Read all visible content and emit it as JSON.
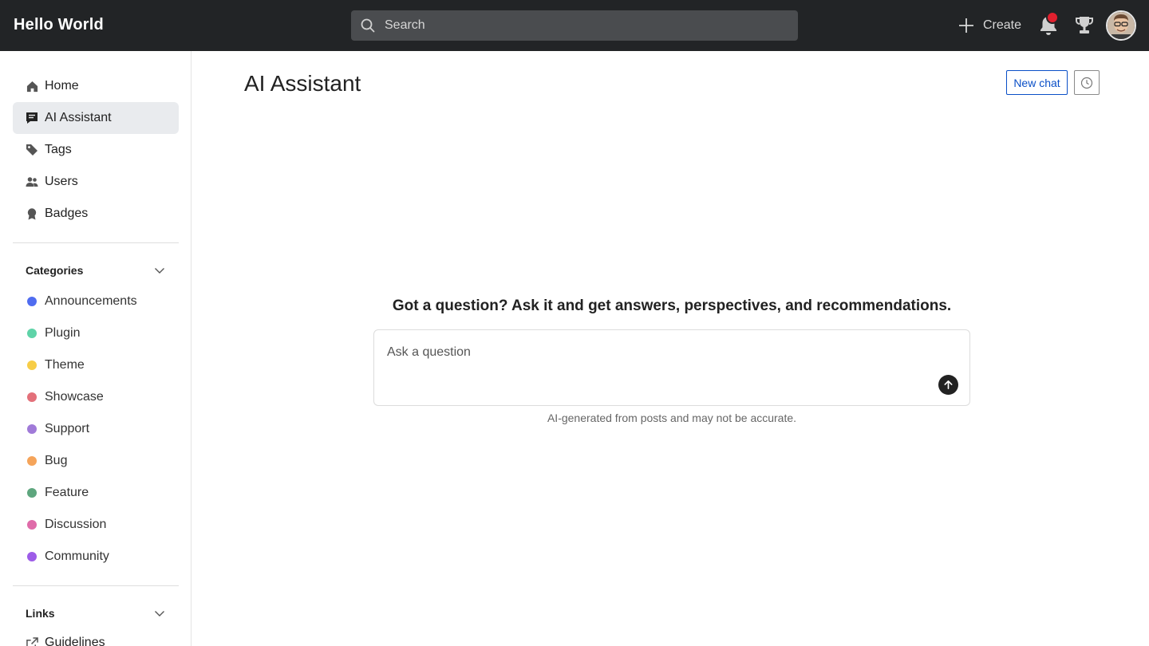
{
  "header": {
    "brand": "Hello World",
    "search_placeholder": "Search",
    "create_label": "Create",
    "notification_color": "#e0202e"
  },
  "sidebar": {
    "nav": [
      {
        "label": "Home",
        "icon": "home-icon"
      },
      {
        "label": "AI Assistant",
        "icon": "chat-icon",
        "active": true
      },
      {
        "label": "Tags",
        "icon": "tag-icon"
      },
      {
        "label": "Users",
        "icon": "users-icon"
      },
      {
        "label": "Badges",
        "icon": "badge-icon"
      }
    ],
    "categories_title": "Categories",
    "categories": [
      {
        "label": "Announcements",
        "color": "#4f6cf0"
      },
      {
        "label": "Plugin",
        "color": "#5fd3a8"
      },
      {
        "label": "Theme",
        "color": "#f7cd47"
      },
      {
        "label": "Showcase",
        "color": "#e3707a"
      },
      {
        "label": "Support",
        "color": "#a07ad8"
      },
      {
        "label": "Bug",
        "color": "#f5a45a"
      },
      {
        "label": "Feature",
        "color": "#5ea67e"
      },
      {
        "label": "Discussion",
        "color": "#df6ba9"
      },
      {
        "label": "Community",
        "color": "#9d5ce8"
      }
    ],
    "links_title": "Links",
    "links": [
      {
        "label": "Guidelines",
        "icon": "external-link-icon"
      }
    ]
  },
  "main": {
    "title": "AI Assistant",
    "new_chat_label": "New chat",
    "prompt": "Got a question? Ask it and get answers, perspectives, and recommendations.",
    "ask_placeholder": "Ask a question",
    "disclaimer": "AI-generated from posts and may not be accurate."
  }
}
